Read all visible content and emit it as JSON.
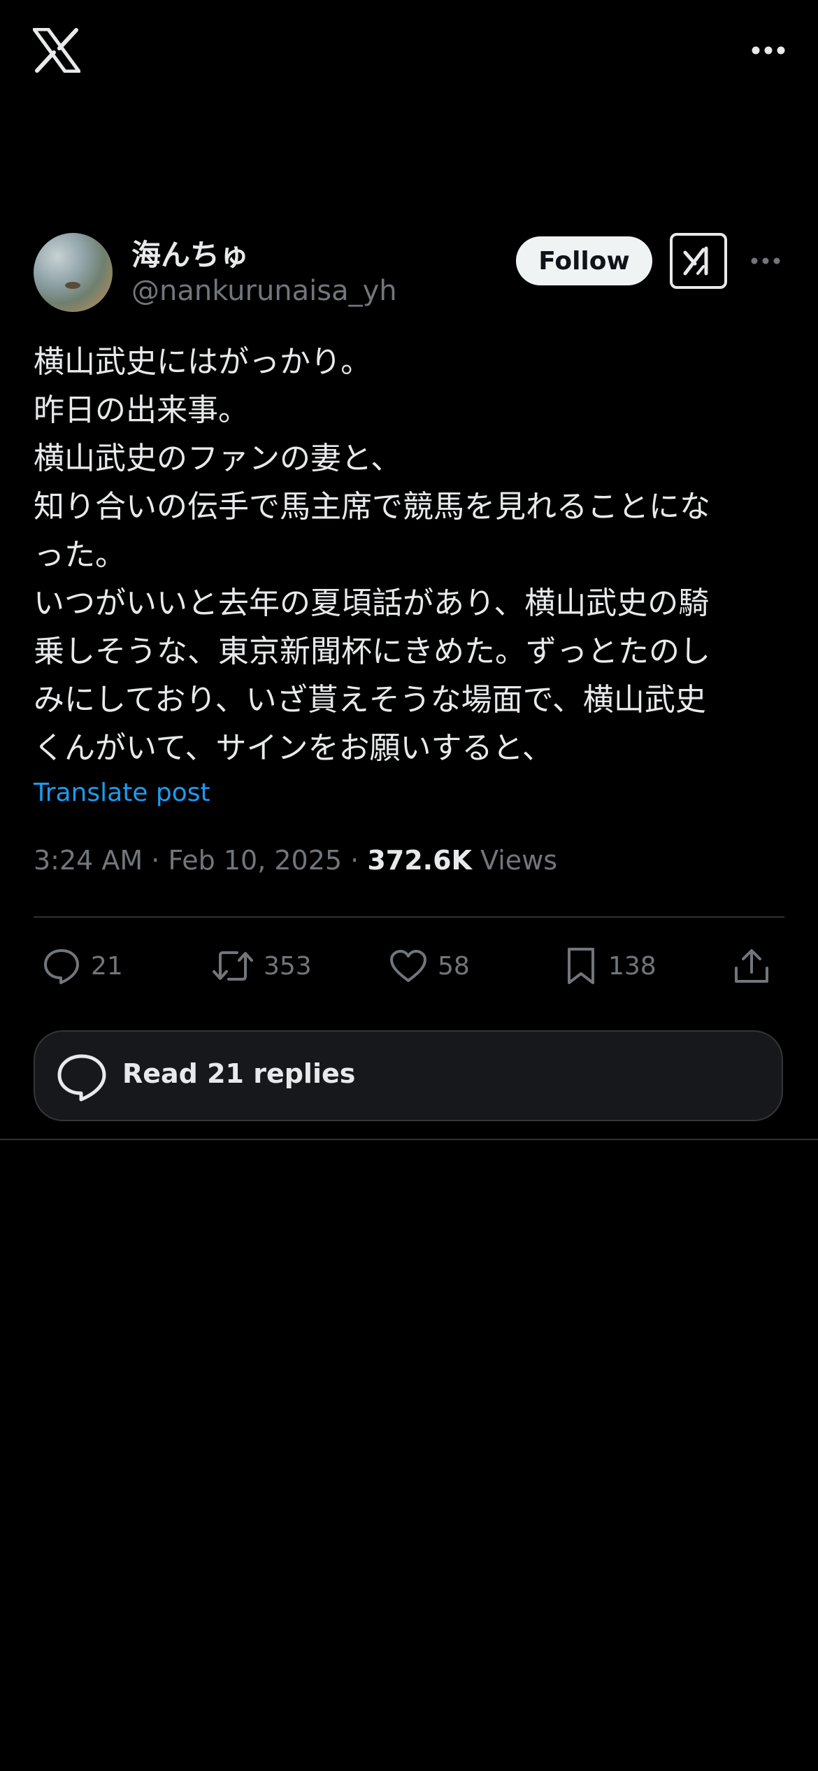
{
  "header": {
    "logo": "x-logo-icon",
    "more_icon": "more-horizontal-icon"
  },
  "author": {
    "display_name": "海んちゅ",
    "handle": "@nankurunaisa_yh",
    "follow_label": "Follow",
    "grok_icon": "grok-icon"
  },
  "tweet": {
    "text": "横山武史にはがっかり。\n昨日の出来事。\n横山武史のファンの妻と、\n知り合いの伝手で馬主席で競馬を見れることにな\nった。\nいつがいいと去年の夏頃話があり、横山武史の騎\n乗しそうな、東京新聞杯にきめた。ずっとたのし\nみにしており、いざ貰えそうな場面で、横山武史\nくんがいて、サインをお願いすると、",
    "translate_label": "Translate post",
    "time": "3:24 AM",
    "separator": "·",
    "date": "Feb 10, 2025",
    "views_count": "372.6K",
    "views_label": "Views"
  },
  "actions": {
    "replies": "21",
    "reposts": "353",
    "likes": "58",
    "bookmarks": "138"
  },
  "read_replies": {
    "label": "Read 21 replies"
  },
  "colors": {
    "background": "#000000",
    "text": "#e7e9ea",
    "secondary": "#71767b",
    "accent": "#1d9bf0",
    "border": "#2f3336"
  }
}
